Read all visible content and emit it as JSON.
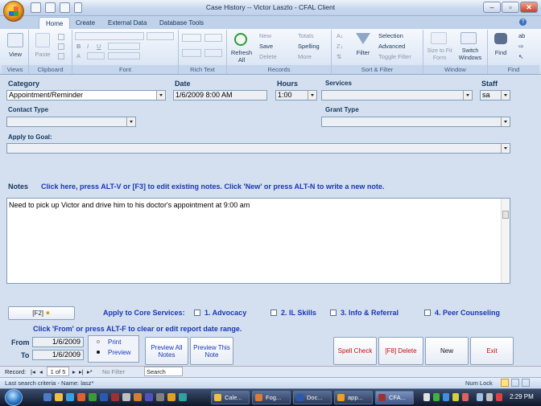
{
  "window": {
    "title": "Case History  --  Victor Laszlo  - CFAL Client"
  },
  "ribbon": {
    "tabs": [
      "Home",
      "Create",
      "External Data",
      "Database Tools"
    ],
    "groups": {
      "views": {
        "label": "Views",
        "view": "View"
      },
      "clipboard": {
        "label": "Clipboard",
        "paste": "Paste"
      },
      "font": {
        "label": "Font"
      },
      "richtext": {
        "label": "Rich Text"
      },
      "records": {
        "label": "Records",
        "refresh": "Refresh All",
        "new": "New",
        "save": "Save",
        "delete": "Delete",
        "totals": "Totals",
        "spelling": "Spelling",
        "more": "More"
      },
      "sortfilter": {
        "label": "Sort & Filter",
        "filter": "Filter",
        "selection": "Selection",
        "advanced": "Advanced",
        "toggle": "Toggle Filter"
      },
      "window": {
        "label": "Window",
        "size": "Size to Fit Form",
        "switch": "Switch Windows"
      },
      "find": {
        "label": "Find",
        "find": "Find"
      }
    }
  },
  "form": {
    "category": {
      "label": "Category",
      "value": "Appointment/Reminder"
    },
    "date": {
      "label": "Date",
      "value": "1/6/2009 8:00 AM"
    },
    "hours": {
      "label": "Hours",
      "value": "1:00"
    },
    "services": {
      "label": "Services",
      "value": ""
    },
    "staff": {
      "label": "Staff",
      "value": "sa"
    },
    "contact_type": {
      "label": "Contact Type",
      "value": ""
    },
    "grant_type": {
      "label": "Grant Type",
      "value": ""
    },
    "apply_to_goal": {
      "label": "Apply to Goal:",
      "value": ""
    },
    "notes": {
      "label": "Notes",
      "hint": "Click here, press ALT-V or [F3] to edit existing notes. Click 'New' or press ALT-N to write a new note.",
      "text": "Need to pick up Victor and drive him to his doctor's appointment at 9:00 am"
    },
    "f2_button": "[F2]",
    "core_services": {
      "label": "Apply to Core Services:",
      "items": [
        "1. Advocacy",
        "2. IL Skills",
        "3. Info & Referral",
        "4. Peer Counseling"
      ]
    },
    "report_hint": "Click 'From' or press ALT-F to clear or edit report date range.",
    "from": {
      "label": "From",
      "value": "1/6/2009"
    },
    "to": {
      "label": "To",
      "value": "1/6/2009"
    },
    "print_option": "Print",
    "preview_option": "Preview",
    "buttons": {
      "preview_all": "Preview All Notes",
      "preview_this": "Preview This Note",
      "spell_check": "Spell Check",
      "delete": "[F8] Delete",
      "new": "New",
      "exit": "Exit"
    }
  },
  "record_nav": {
    "label": "Record:",
    "position": "1 of 5",
    "filter": "No Filter",
    "search": "Search"
  },
  "status_bar": {
    "left": "Last search criteria - Name: lasz*",
    "numlock": "Num Lock"
  },
  "taskbar": {
    "tasks": [
      "Cale...",
      "Fog...",
      "Doc...",
      "app...",
      "CFA..."
    ],
    "clock": "2:29 PM"
  }
}
